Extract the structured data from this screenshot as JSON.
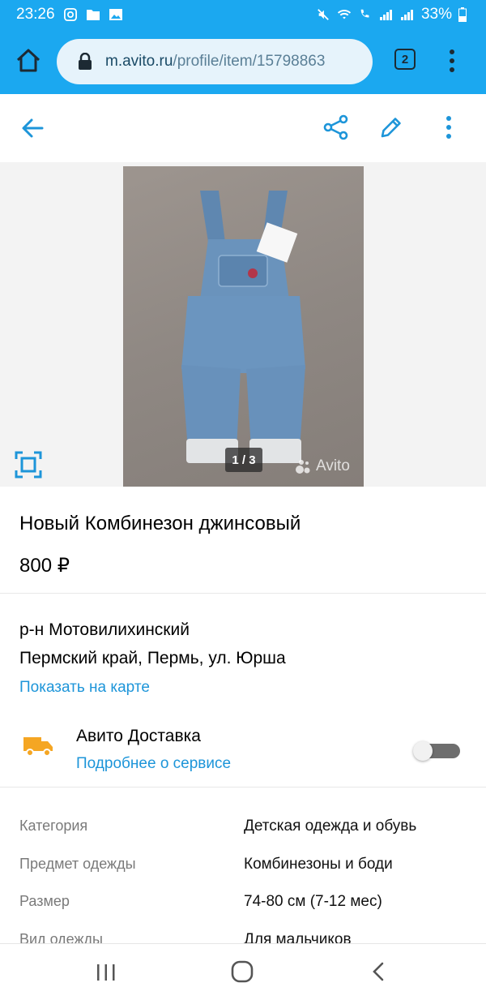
{
  "status_bar": {
    "time": "23:26",
    "battery": "33%"
  },
  "browser": {
    "url_host": "m.avito.ru",
    "url_path": "/profile/item/15798863",
    "tab_count": "2"
  },
  "gallery": {
    "counter": "1 / 3",
    "watermark": "Avito"
  },
  "listing": {
    "title": "Новый Комбинезон джинсовый",
    "price": "800 ₽",
    "district": "р-н Мотовилихинский",
    "address": "Пермский край, Пермь, ул. Юрша",
    "map_link": "Показать на карте"
  },
  "delivery": {
    "title": "Авито Доставка",
    "link": "Подробнее о сервисе",
    "enabled": false
  },
  "params": [
    {
      "label": "Категория",
      "value": "Детская одежда и обувь"
    },
    {
      "label": "Предмет одежды",
      "value": "Комбинезоны и боди"
    },
    {
      "label": "Размер",
      "value": "74-80 см (7-12 мес)"
    },
    {
      "label": "Вид одежды",
      "value": "Для мальчиков"
    }
  ],
  "colors": {
    "accent": "#1ba8f0",
    "link": "#1d95d9",
    "delivery_icon": "#f5a623"
  }
}
